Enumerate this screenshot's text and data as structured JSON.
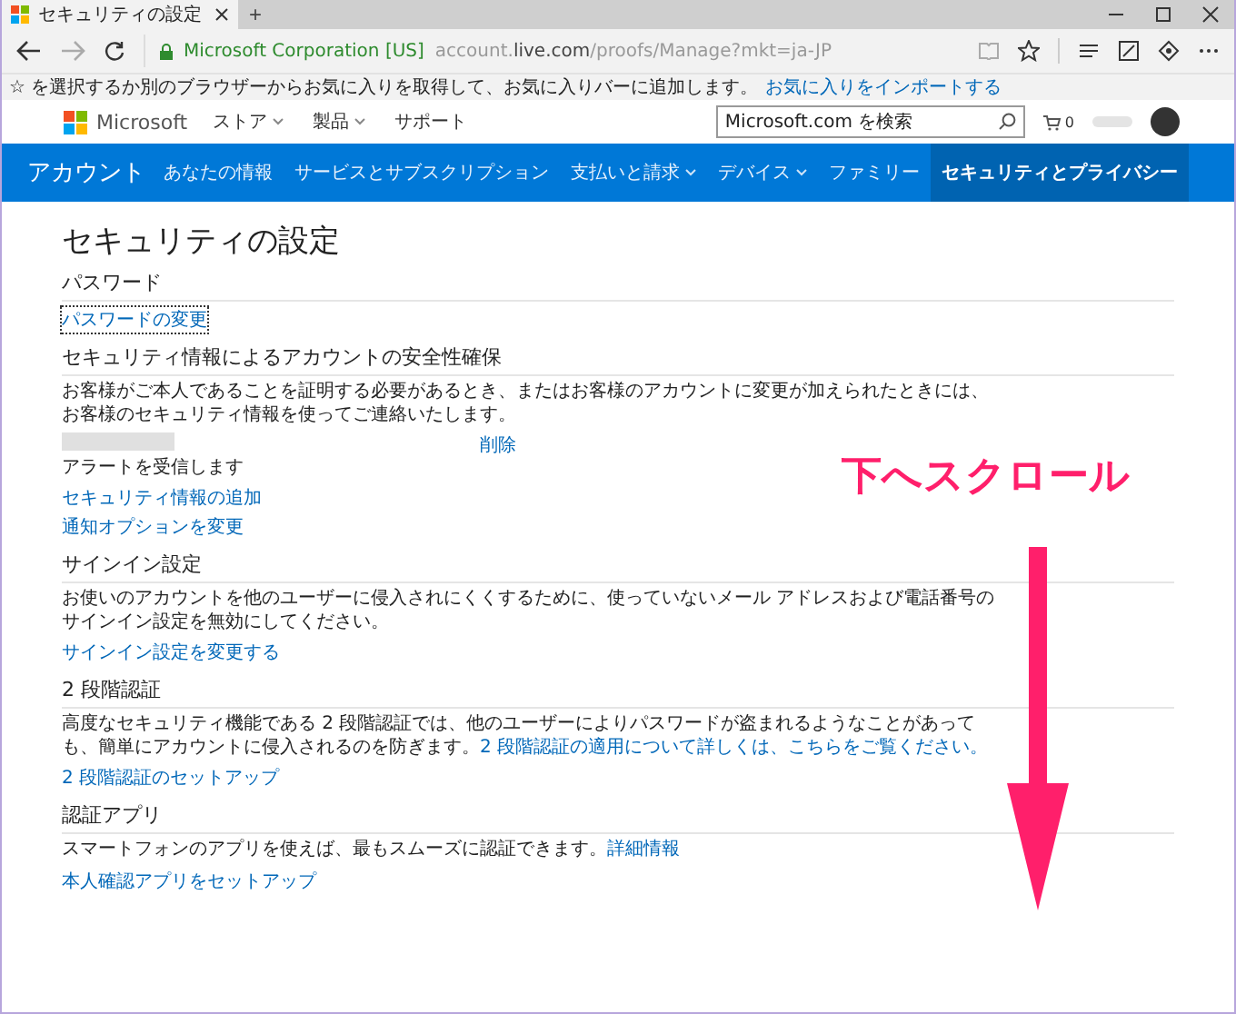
{
  "browser": {
    "tab_title": "セキュリティの設定",
    "new_tab": "+",
    "site_identity": "Microsoft Corporation [US]",
    "url": {
      "prefix": "account.",
      "domain": "live.com",
      "path": "/proofs/Manage?mkt=ja-JP"
    },
    "favorites_message": "☆ を選択するか別のブラウザーからお気に入りを取得して、お気に入りバーに追加します。",
    "favorites_link": "お気に入りをインポートする"
  },
  "header": {
    "brand": "Microsoft",
    "nav": [
      {
        "label": "ストア",
        "dropdown": true
      },
      {
        "label": "製品",
        "dropdown": true
      },
      {
        "label": "サポート",
        "dropdown": false
      }
    ],
    "search": {
      "placeholder": "Microsoft.com を検索"
    },
    "cart_count": "0"
  },
  "account_nav": {
    "title": "アカウント",
    "items": [
      {
        "label": "あなたの情報",
        "dropdown": false,
        "selected": false
      },
      {
        "label": "サービスとサブスクリプション",
        "dropdown": false,
        "selected": false
      },
      {
        "label": "支払いと請求",
        "dropdown": true,
        "selected": false
      },
      {
        "label": "デバイス",
        "dropdown": true,
        "selected": false
      },
      {
        "label": "ファミリー",
        "dropdown": false,
        "selected": false
      },
      {
        "label": "セキュリティとプライバシー",
        "dropdown": false,
        "selected": true
      }
    ]
  },
  "page_title": "セキュリティの設定",
  "sections": [
    {
      "heading": "パスワード",
      "links": [
        {
          "label": "パスワードの変更",
          "focused": true
        }
      ]
    },
    {
      "heading": "セキュリティ情報によるアカウントの安全性確保",
      "description": {
        "text": "お客様がご本人であることを証明する必要があるとき、またはお客様のアカウントに変更が加えられたときには、お客様のセキュリティ情報を使ってご連絡いたします。"
      },
      "proof": {
        "note": "アラートを受信します",
        "action": "削除"
      },
      "links": [
        {
          "label": "セキュリティ情報の追加",
          "focused": false
        },
        {
          "label": "通知オプションを変更",
          "focused": false
        }
      ]
    },
    {
      "heading": "サインイン設定",
      "description": {
        "text": "お使いのアカウントを他のユーザーに侵入されにくくするために、使っていないメール アドレスおよび電話番号のサインイン設定を無効にしてください。"
      },
      "links": [
        {
          "label": "サインイン設定を変更する",
          "focused": false
        }
      ]
    },
    {
      "heading": "2 段階認証",
      "description": {
        "text": "高度なセキュリティ機能である 2 段階認証では、他のユーザーによりパスワードが盗まれるようなことがあっても、簡単にアカウントに侵入されるのを防ぎます。",
        "link": "2 段階認証の適用について詳しくは、こちらをご覧ください。"
      },
      "links": [
        {
          "label": "2 段階認証のセットアップ",
          "focused": false
        }
      ]
    },
    {
      "heading": "認証アプリ",
      "description": {
        "text": "スマートフォンのアプリを使えば、最もスムーズに認証できます。",
        "link": "詳細情報"
      },
      "links": [
        {
          "label": "本人確認アプリをセットアップ",
          "focused": false
        }
      ]
    }
  ],
  "annotation": {
    "text": "下へスクロール"
  }
}
